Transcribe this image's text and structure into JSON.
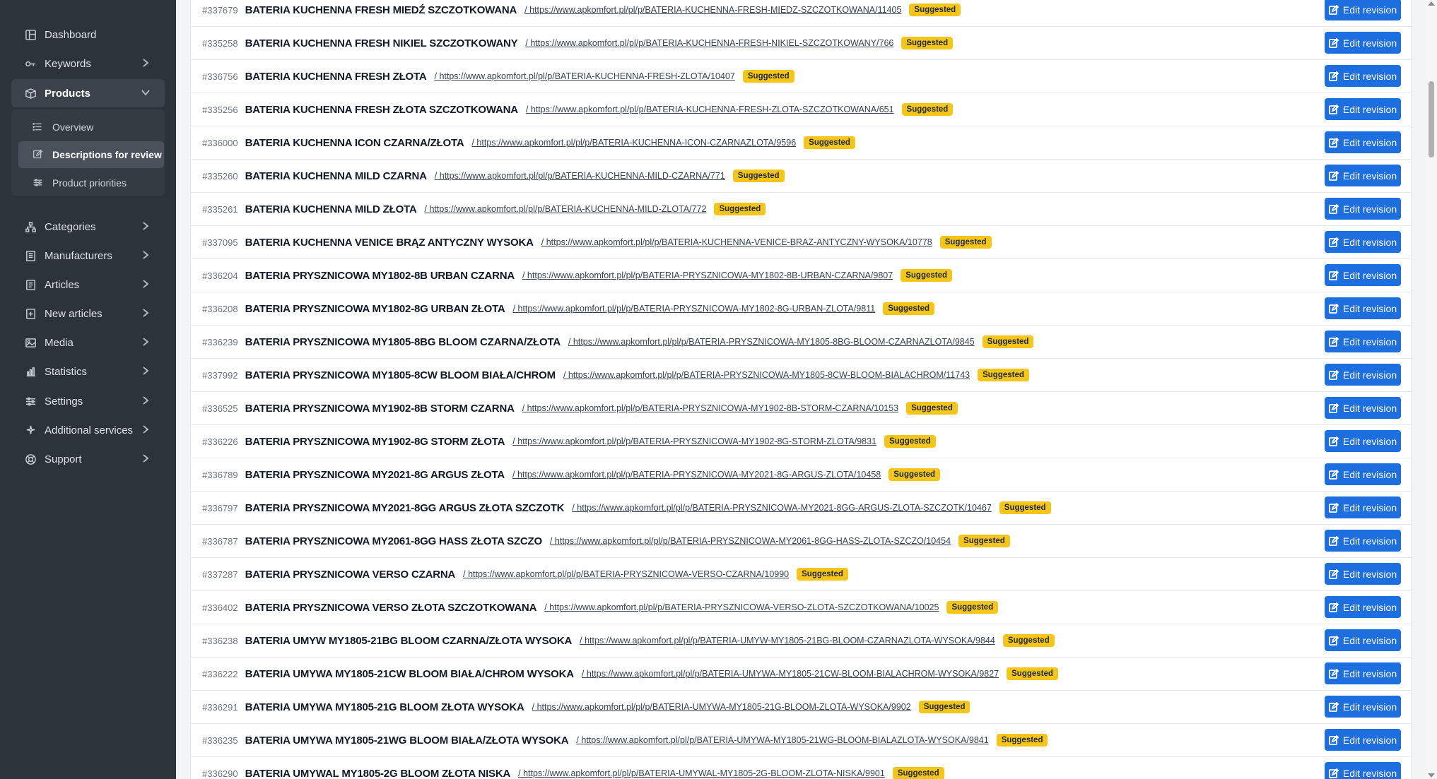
{
  "sidebar": {
    "items": [
      {
        "label": "Dashboard",
        "icon": "dashboard-icon",
        "chevron": false
      },
      {
        "label": "Keywords",
        "icon": "key-icon",
        "chevron": true
      },
      {
        "label": "Products",
        "icon": "box-icon",
        "chevron": true,
        "expanded": true
      },
      {
        "label": "Categories",
        "icon": "sitemap-icon",
        "chevron": true
      },
      {
        "label": "Manufacturers",
        "icon": "building-icon",
        "chevron": true
      },
      {
        "label": "Articles",
        "icon": "article-icon",
        "chevron": true
      },
      {
        "label": "New articles",
        "icon": "new-article-icon",
        "chevron": true
      },
      {
        "label": "Media",
        "icon": "image-icon",
        "chevron": true
      },
      {
        "label": "Statistics",
        "icon": "chart-icon",
        "chevron": true
      },
      {
        "label": "Settings",
        "icon": "sliders-icon",
        "chevron": true
      },
      {
        "label": "Additional services",
        "icon": "sparkle-icon",
        "chevron": true
      },
      {
        "label": "Support",
        "icon": "lifebuoy-icon",
        "chevron": true
      }
    ],
    "products_submenu": [
      {
        "label": "Overview",
        "icon": "list-icon"
      },
      {
        "label": "Descriptions for review",
        "icon": "edit-icon"
      },
      {
        "label": "Product priorities",
        "icon": "sliders-icon"
      }
    ]
  },
  "rows": [
    {
      "id": "#337679",
      "name": "BATERIA KUCHENNA FRESH MIEDŹ SZCZOTKOWANA",
      "url": "/ https://www.apkomfort.pl/pl/p/BATERIA-KUCHENNA-FRESH-MIEDZ-SZCZOTKOWANA/11405",
      "status": "Suggested",
      "action": "Edit revision"
    },
    {
      "id": "#335258",
      "name": "BATERIA KUCHENNA FRESH NIKIEL SZCZOTKOWANY",
      "url": "/ https://www.apkomfort.pl/pl/p/BATERIA-KUCHENNA-FRESH-NIKIEL-SZCZOTKOWANY/766",
      "status": "Suggested",
      "action": "Edit revision"
    },
    {
      "id": "#336756",
      "name": "BATERIA KUCHENNA FRESH ZŁOTA",
      "url": "/ https://www.apkomfort.pl/pl/p/BATERIA-KUCHENNA-FRESH-ZLOTA/10407",
      "status": "Suggested",
      "action": "Edit revision"
    },
    {
      "id": "#335256",
      "name": "BATERIA KUCHENNA FRESH ZŁOTA SZCZOTKOWANA",
      "url": "/ https://www.apkomfort.pl/pl/p/BATERIA-KUCHENNA-FRESH-ZLOTA-SZCZOTKOWANA/651",
      "status": "Suggested",
      "action": "Edit revision"
    },
    {
      "id": "#336000",
      "name": "BATERIA KUCHENNA ICON CZARNA/ZŁOTA",
      "url": "/ https://www.apkomfort.pl/pl/p/BATERIA-KUCHENNA-ICON-CZARNAZLOTA/9596",
      "status": "Suggested",
      "action": "Edit revision"
    },
    {
      "id": "#335260",
      "name": "BATERIA KUCHENNA MILD CZARNA",
      "url": "/ https://www.apkomfort.pl/pl/p/BATERIA-KUCHENNA-MILD-CZARNA/771",
      "status": "Suggested",
      "action": "Edit revision"
    },
    {
      "id": "#335261",
      "name": "BATERIA KUCHENNA MILD ZŁOTA",
      "url": "/ https://www.apkomfort.pl/pl/p/BATERIA-KUCHENNA-MILD-ZLOTA/772",
      "status": "Suggested",
      "action": "Edit revision"
    },
    {
      "id": "#337095",
      "name": "BATERIA KUCHENNA VENICE BRĄZ ANTYCZNY WYSOKA",
      "url": "/ https://www.apkomfort.pl/pl/p/BATERIA-KUCHENNA-VENICE-BRAZ-ANTYCZNY-WYSOKA/10778",
      "status": "Suggested",
      "action": "Edit revision"
    },
    {
      "id": "#336204",
      "name": "BATERIA PRYSZNICOWA MY1802-8B URBAN CZARNA",
      "url": "/ https://www.apkomfort.pl/pl/p/BATERIA-PRYSZNICOWA-MY1802-8B-URBAN-CZARNA/9807",
      "status": "Suggested",
      "action": "Edit revision"
    },
    {
      "id": "#336208",
      "name": "BATERIA PRYSZNICOWA MY1802-8G URBAN ZŁOTA",
      "url": "/ https://www.apkomfort.pl/pl/p/BATERIA-PRYSZNICOWA-MY1802-8G-URBAN-ZLOTA/9811",
      "status": "Suggested",
      "action": "Edit revision"
    },
    {
      "id": "#336239",
      "name": "BATERIA PRYSZNICOWA MY1805-8BG BLOOM CZARNA/ZŁOTA",
      "url": "/ https://www.apkomfort.pl/pl/p/BATERIA-PRYSZNICOWA-MY1805-8BG-BLOOM-CZARNAZLOTA/9845",
      "status": "Suggested",
      "action": "Edit revision"
    },
    {
      "id": "#337992",
      "name": "BATERIA PRYSZNICOWA MY1805-8CW BLOOM BIAŁA/CHROM",
      "url": "/ https://www.apkomfort.pl/pl/p/BATERIA-PRYSZNICOWA-MY1805-8CW-BLOOM-BIALACHROM/11743",
      "status": "Suggested",
      "action": "Edit revision"
    },
    {
      "id": "#336525",
      "name": "BATERIA PRYSZNICOWA MY1902-8B STORM CZARNA",
      "url": "/ https://www.apkomfort.pl/pl/p/BATERIA-PRYSZNICOWA-MY1902-8B-STORM-CZARNA/10153",
      "status": "Suggested",
      "action": "Edit revision"
    },
    {
      "id": "#336226",
      "name": "BATERIA PRYSZNICOWA MY1902-8G STORM ZŁOTA",
      "url": "/ https://www.apkomfort.pl/pl/p/BATERIA-PRYSZNICOWA-MY1902-8G-STORM-ZLOTA/9831",
      "status": "Suggested",
      "action": "Edit revision"
    },
    {
      "id": "#336789",
      "name": "BATERIA PRYSZNICOWA MY2021-8G ARGUS ZŁOTA",
      "url": "/ https://www.apkomfort.pl/pl/p/BATERIA-PRYSZNICOWA-MY2021-8G-ARGUS-ZLOTA/10458",
      "status": "Suggested",
      "action": "Edit revision"
    },
    {
      "id": "#336797",
      "name": "BATERIA PRYSZNICOWA MY2021-8GG ARGUS ZŁOTA SZCZOTK",
      "url": "/ https://www.apkomfort.pl/pl/p/BATERIA-PRYSZNICOWA-MY2021-8GG-ARGUS-ZLOTA-SZCZOTK/10467",
      "status": "Suggested",
      "action": "Edit revision"
    },
    {
      "id": "#336787",
      "name": "BATERIA PRYSZNICOWA MY2061-8GG HASS ZŁOTA SZCZO",
      "url": "/ https://www.apkomfort.pl/pl/p/BATERIA-PRYSZNICOWA-MY2061-8GG-HASS-ZLOTA-SZCZO/10454",
      "status": "Suggested",
      "action": "Edit revision"
    },
    {
      "id": "#337287",
      "name": "BATERIA PRYSZNICOWA VERSO CZARNA",
      "url": "/ https://www.apkomfort.pl/pl/p/BATERIA-PRYSZNICOWA-VERSO-CZARNA/10990",
      "status": "Suggested",
      "action": "Edit revision"
    },
    {
      "id": "#336402",
      "name": "BATERIA PRYSZNICOWA VERSO ZŁOTA SZCZOTKOWANA",
      "url": "/ https://www.apkomfort.pl/pl/p/BATERIA-PRYSZNICOWA-VERSO-ZLOTA-SZCZOTKOWANA/10025",
      "status": "Suggested",
      "action": "Edit revision"
    },
    {
      "id": "#336238",
      "name": "BATERIA UMYW MY1805-21BG BLOOM CZARNA/ZŁOTA WYSOKA",
      "url": "/ https://www.apkomfort.pl/pl/p/BATERIA-UMYW-MY1805-21BG-BLOOM-CZARNAZLOTA-WYSOKA/9844",
      "status": "Suggested",
      "action": "Edit revision"
    },
    {
      "id": "#336222",
      "name": "BATERIA UMYWA MY1805-21CW BLOOM BIAŁA/CHROM WYSOKA",
      "url": "/ https://www.apkomfort.pl/pl/p/BATERIA-UMYWA-MY1805-21CW-BLOOM-BIALACHROM-WYSOKA/9827",
      "status": "Suggested",
      "action": "Edit revision"
    },
    {
      "id": "#336291",
      "name": "BATERIA UMYWA MY1805-21G BLOOM ZŁOTA WYSOKA",
      "url": "/ https://www.apkomfort.pl/pl/p/BATERIA-UMYWA-MY1805-21G-BLOOM-ZLOTA-WYSOKA/9902",
      "status": "Suggested",
      "action": "Edit revision"
    },
    {
      "id": "#336235",
      "name": "BATERIA UMYWA MY1805-21WG BLOOM BIAŁA/ZŁOTA WYSOKA",
      "url": "/ https://www.apkomfort.pl/pl/p/BATERIA-UMYWA-MY1805-21WG-BLOOM-BIALAZLOTA-WYSOKA/9841",
      "status": "Suggested",
      "action": "Edit revision"
    },
    {
      "id": "#336290",
      "name": "BATERIA UMYWAL MY1805-2G BLOOM ZŁOTA NISKA",
      "url": "/ https://www.apkomfort.pl/pl/p/BATERIA-UMYWAL-MY1805-2G-BLOOM-ZLOTA-NISKA/9901",
      "status": "Suggested",
      "action": "Edit revision"
    }
  ],
  "colors": {
    "sidebar_bg": "#2d333b",
    "button_blue": "#1d6fe0",
    "badge_yellow": "#f5c518"
  }
}
